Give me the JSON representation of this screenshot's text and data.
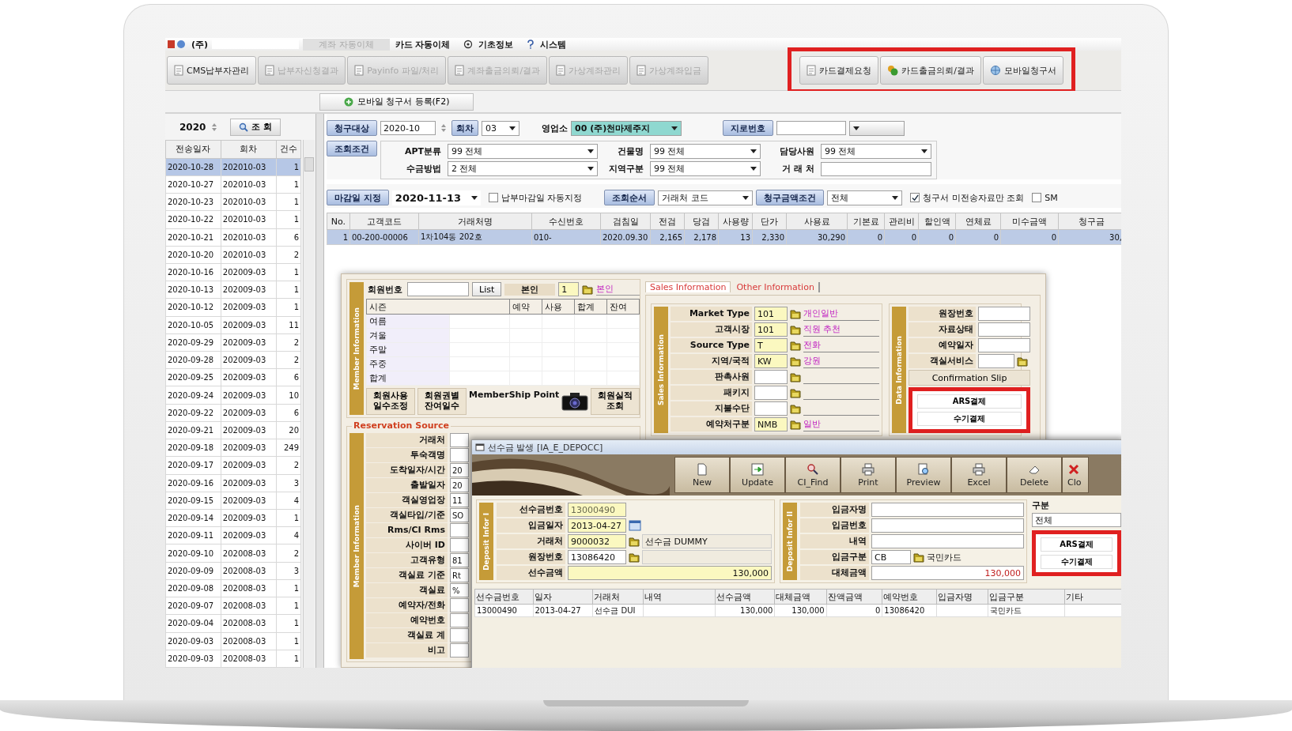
{
  "menu_bar": {
    "company": "(주)",
    "items": [
      {
        "label": "계좌 자동이체",
        "disabled": true
      },
      {
        "label": "카드 자동이체",
        "disabled": false
      },
      {
        "label": "기초정보",
        "disabled": false
      },
      {
        "label": "시스템",
        "disabled": false
      }
    ]
  },
  "toolbar": {
    "tabs": [
      {
        "label": "CMS납부자관리",
        "disabled": false
      },
      {
        "label": "납부자신청결과",
        "disabled": true
      },
      {
        "label": "Payinfo 파일/처리",
        "disabled": true
      },
      {
        "label": "계좌출금의뢰/결과",
        "disabled": true
      },
      {
        "label": "가상계좌관리",
        "disabled": true
      },
      {
        "label": "가상계좌입금",
        "disabled": true
      }
    ],
    "highlighted_tabs": [
      {
        "label": "카드결제요청",
        "kind": "sheet"
      },
      {
        "label": "카드출금의뢰/결과",
        "kind": "coins"
      },
      {
        "label": "모바일청구서",
        "kind": "globe"
      }
    ]
  },
  "register_button": "모바일 청구서 등록(F2)",
  "left_panel": {
    "year": "2020",
    "search_button": "조 회",
    "columns": [
      "전송일자",
      "회차",
      "건수"
    ],
    "rows": [
      {
        "date": "2020-10-28",
        "round": "202010-03",
        "count": "1",
        "selected": true
      },
      {
        "date": "2020-10-27",
        "round": "202010-03",
        "count": "1",
        "selected": false
      },
      {
        "date": "2020-10-23",
        "round": "202010-03",
        "count": "1",
        "selected": false
      },
      {
        "date": "2020-10-22",
        "round": "202010-03",
        "count": "1",
        "selected": false
      },
      {
        "date": "2020-10-21",
        "round": "202010-03",
        "count": "6",
        "selected": false
      },
      {
        "date": "2020-10-20",
        "round": "202010-03",
        "count": "2",
        "selected": false
      },
      {
        "date": "2020-10-16",
        "round": "202009-03",
        "count": "1",
        "selected": false
      },
      {
        "date": "2020-10-13",
        "round": "202009-03",
        "count": "1",
        "selected": false
      },
      {
        "date": "2020-10-12",
        "round": "202009-03",
        "count": "1",
        "selected": false
      },
      {
        "date": "2020-10-05",
        "round": "202009-03",
        "count": "11",
        "selected": false
      },
      {
        "date": "2020-09-29",
        "round": "202009-03",
        "count": "2",
        "selected": false
      },
      {
        "date": "2020-09-28",
        "round": "202009-03",
        "count": "2",
        "selected": false
      },
      {
        "date": "2020-09-25",
        "round": "202009-03",
        "count": "6",
        "selected": false
      },
      {
        "date": "2020-09-24",
        "round": "202009-03",
        "count": "10",
        "selected": false
      },
      {
        "date": "2020-09-22",
        "round": "202009-03",
        "count": "6",
        "selected": false
      },
      {
        "date": "2020-09-21",
        "round": "202009-03",
        "count": "20",
        "selected": false
      },
      {
        "date": "2020-09-18",
        "round": "202009-03",
        "count": "249",
        "selected": false
      },
      {
        "date": "2020-09-17",
        "round": "202009-03",
        "count": "2",
        "selected": false
      },
      {
        "date": "2020-09-16",
        "round": "202009-03",
        "count": "3",
        "selected": false
      },
      {
        "date": "2020-09-15",
        "round": "202009-03",
        "count": "4",
        "selected": false
      },
      {
        "date": "2020-09-14",
        "round": "202009-03",
        "count": "1",
        "selected": false
      },
      {
        "date": "2020-09-11",
        "round": "202009-03",
        "count": "4",
        "selected": false
      },
      {
        "date": "2020-09-10",
        "round": "202008-03",
        "count": "2",
        "selected": false
      },
      {
        "date": "2020-09-09",
        "round": "202008-03",
        "count": "3",
        "selected": false
      },
      {
        "date": "2020-09-08",
        "round": "202008-03",
        "count": "1",
        "selected": false
      },
      {
        "date": "2020-09-07",
        "round": "202008-03",
        "count": "1",
        "selected": false
      },
      {
        "date": "2020-09-04",
        "round": "202008-03",
        "count": "1",
        "selected": false
      },
      {
        "date": "2020-09-03",
        "round": "202008-03",
        "count": "1",
        "selected": false
      },
      {
        "date": "2020-09-03",
        "round": "202008-03",
        "count": "1",
        "selected": false
      }
    ]
  },
  "filters": {
    "billing_target": {
      "button": "청구대상",
      "value": "2020-10"
    },
    "round": {
      "button": "회차",
      "value": "03"
    },
    "branch": {
      "label": "영업소",
      "value": "00 (주)천마제주지"
    },
    "giro": {
      "button": "지로번호"
    },
    "conditions": {
      "button": "조회조건",
      "fields": [
        {
          "label": "APT분류",
          "value": "99 전체",
          "kind": "select"
        },
        {
          "label": "건물명",
          "value": "99 전체",
          "kind": "select"
        },
        {
          "label": "담당사원",
          "value": "99 전체",
          "kind": "select"
        },
        {
          "label": "수금방법",
          "value": "2 전체",
          "kind": "select"
        },
        {
          "label": "지역구분",
          "value": "99 전체",
          "kind": "select"
        },
        {
          "label": "거 래 처",
          "kind": "text"
        }
      ]
    },
    "deadline": {
      "button": "마감일 지정",
      "value": "2020-11-13",
      "auto": {
        "label": "납부마감일 자동지정",
        "checked": false
      }
    },
    "order": {
      "button": "조회순서",
      "value": "거래처 코드"
    },
    "amount": {
      "button": "청구금액조건",
      "value": "전체"
    },
    "checkboxes": [
      {
        "label": "청구서 미전송자료만 조회",
        "checked": true
      },
      {
        "label": "SM",
        "checked": false
      }
    ]
  },
  "grid": {
    "columns": [
      "No.",
      "고객코드",
      "거래처명",
      "수신번호",
      "검침일",
      "전검",
      "당검",
      "사용량",
      "단가",
      "사용료",
      "기본료",
      "관리비",
      "할인액",
      "연체료",
      "미수금액",
      "청구금"
    ],
    "rows": [
      {
        "selected": true,
        "cells": [
          "1",
          "00-200-00006",
          "1차104동 202호",
          "010-",
          "2020.09.30",
          "2,165",
          "2,178",
          "13",
          "2,330",
          "30,290",
          "0",
          "0",
          "0",
          "0",
          "0",
          "30,"
        ]
      }
    ]
  },
  "member_window": {
    "member_panel": {
      "band": "Member Information",
      "member_no_label": "회원번호",
      "list_button": "List",
      "self_label": "본인",
      "self_code": "1",
      "self_name": "본인",
      "season_table": {
        "columns": [
          "시즌",
          "예약",
          "사용",
          "합계",
          "잔여"
        ],
        "rows": [
          "여름",
          "겨울",
          "주말",
          "주중",
          "합계"
        ]
      },
      "buttons": [
        "회원사용 일수조정",
        "회원권별 잔여일수"
      ],
      "point_label": "MemberShip Point",
      "result_button": "회원실적 조회"
    },
    "reservation": {
      "legend": "Reservation Source",
      "band": "Member Information",
      "fields": [
        {
          "label": "거래처"
        },
        {
          "label": "투숙객명"
        },
        {
          "label": "도착일자/시간",
          "value": "20"
        },
        {
          "label": "출발일자",
          "value": "20"
        },
        {
          "label": "객실영업장",
          "value": "11"
        },
        {
          "label": "객실타입/기준",
          "value": "SO"
        },
        {
          "label": "Rms/CI Rms"
        },
        {
          "label": "사이버 ID"
        },
        {
          "label": "고객유형",
          "value": "81"
        },
        {
          "label": "객실료 기준",
          "value": "Rt"
        },
        {
          "label": "객실료",
          "value": "%"
        },
        {
          "label": "예약자/전화"
        },
        {
          "label": "예약번호"
        },
        {
          "label": "객실료 계"
        },
        {
          "label": "비고"
        }
      ]
    },
    "tabs": [
      {
        "label": "Sales Information",
        "selected": true
      },
      {
        "label": "Other Information",
        "selected": false
      }
    ],
    "sales": {
      "band": "Sales Information",
      "rows": [
        {
          "label": "Market Type",
          "code": "101",
          "name": "개인일반"
        },
        {
          "label": "고객시장",
          "code": "101",
          "name": "직원 추천"
        },
        {
          "label": "Source Type",
          "code": "T",
          "name": "전화"
        },
        {
          "label": "지역/국적",
          "code": "KW",
          "name": "강원"
        },
        {
          "label": "판촉사원"
        },
        {
          "label": "패키지"
        },
        {
          "label": "지불수단"
        },
        {
          "label": "예약처구분",
          "code": "NMB",
          "name": "일반"
        }
      ]
    },
    "data": {
      "band": "Data Information",
      "fields": [
        {
          "label": "원장번호",
          "lookup": false
        },
        {
          "label": "자료상태",
          "lookup": false
        },
        {
          "label": "예약일자",
          "lookup": false
        },
        {
          "label": "객실서비스",
          "lookup": true
        }
      ],
      "slip_button": "Confirmation Slip",
      "pay_buttons": [
        "ARS결제",
        "수기결제"
      ]
    }
  },
  "deposit_window": {
    "title": "선수금 발생 [IA_E_DEPOCC]",
    "tools": [
      {
        "label": "New",
        "kind": "new"
      },
      {
        "label": "Update",
        "kind": "update"
      },
      {
        "label": "CI_Find",
        "kind": "find"
      },
      {
        "label": "Print",
        "kind": "print"
      },
      {
        "label": "Preview",
        "kind": "preview"
      },
      {
        "label": "Excel",
        "kind": "excel"
      },
      {
        "label": "Delete",
        "kind": "delete"
      },
      {
        "label": "Clo",
        "kind": "close"
      }
    ],
    "info1": {
      "band": "Deposit Infor I",
      "fields": [
        {
          "label": "선수금번호",
          "value": "13000490",
          "kind": "readonly"
        },
        {
          "label": "입금일자",
          "value": "2013-04-27",
          "kind": "date"
        },
        {
          "label": "거래처",
          "value": "9000032",
          "kind": "lookup",
          "name": "선수금 DUMMY"
        },
        {
          "label": "원장번호",
          "value": "13086420",
          "kind": "lookup"
        },
        {
          "label": "선수금액",
          "value": "130,000",
          "kind": "amount"
        }
      ]
    },
    "info2": {
      "band": "Deposit Infor II",
      "fields": [
        {
          "label": "입금자명",
          "kind": "text"
        },
        {
          "label": "입금번호",
          "kind": "text"
        },
        {
          "label": "내역",
          "kind": "text"
        },
        {
          "label": "입금구분",
          "value": "CB",
          "kind": "lookup",
          "name": "국민카드"
        },
        {
          "label": "대체금액",
          "value": "130,000",
          "kind": "amount"
        }
      ]
    },
    "type_group": {
      "legend": "구분",
      "value": "전체",
      "pay_buttons": [
        "ARS결제",
        "수기결제"
      ]
    },
    "grid": {
      "columns": [
        "선수금번호",
        "일자",
        "거래처",
        "내역",
        "선수금액",
        "대체금액",
        "잔액금액",
        "예약번호",
        "입금자명",
        "입금구분",
        "기타"
      ],
      "rows": [
        [
          "13000490",
          "2013-04-27",
          "선수금 DUI",
          "",
          "130,000",
          "130,000",
          "0",
          "13086420",
          "",
          "국민카드",
          ""
        ]
      ]
    }
  }
}
